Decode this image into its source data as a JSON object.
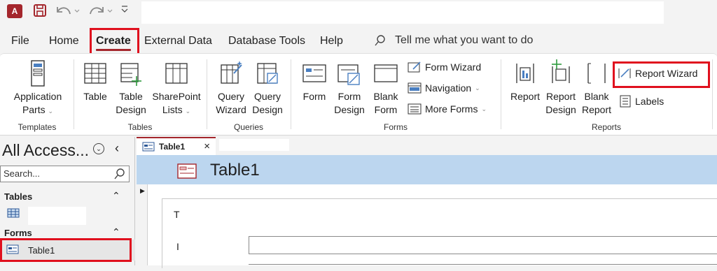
{
  "app": {
    "logo_letter": "A",
    "title": ""
  },
  "menu": {
    "tabs": [
      "File",
      "Home",
      "Create",
      "External Data",
      "Database Tools",
      "Help"
    ],
    "active_tab": "Create",
    "tell_me": "Tell me what you want to do"
  },
  "ribbon": {
    "templates": {
      "label": "Templates",
      "app_parts": [
        "Application",
        "Parts"
      ]
    },
    "tables": {
      "label": "Tables",
      "table": "Table",
      "table_design": [
        "Table",
        "Design"
      ],
      "sharepoint": [
        "SharePoint",
        "Lists"
      ]
    },
    "queries": {
      "label": "Queries",
      "wizard": [
        "Query",
        "Wizard"
      ],
      "design": [
        "Query",
        "Design"
      ]
    },
    "forms": {
      "label": "Forms",
      "form": "Form",
      "form_design": [
        "Form",
        "Design"
      ],
      "blank_form": [
        "Blank",
        "Form"
      ],
      "form_wizard": "Form Wizard",
      "navigation": "Navigation",
      "more_forms": "More Forms"
    },
    "reports": {
      "label": "Reports",
      "report": "Report",
      "report_design": [
        "Report",
        "Design"
      ],
      "blank_report": [
        "Blank",
        "Report"
      ],
      "report_wizard": "Report Wizard",
      "labels": "Labels"
    }
  },
  "nav": {
    "title": "All Access...",
    "search_placeholder": "Search...",
    "sections": [
      {
        "name": "Tables"
      },
      {
        "name": "Forms",
        "items": [
          "Table1"
        ]
      }
    ]
  },
  "document": {
    "tab_label": "Table1",
    "form_title": "Table1",
    "labels": [
      "T",
      "I"
    ]
  },
  "colors": {
    "accent": "#a4262c",
    "highlight": "#e0101e",
    "form_header": "#bcd6ef"
  }
}
